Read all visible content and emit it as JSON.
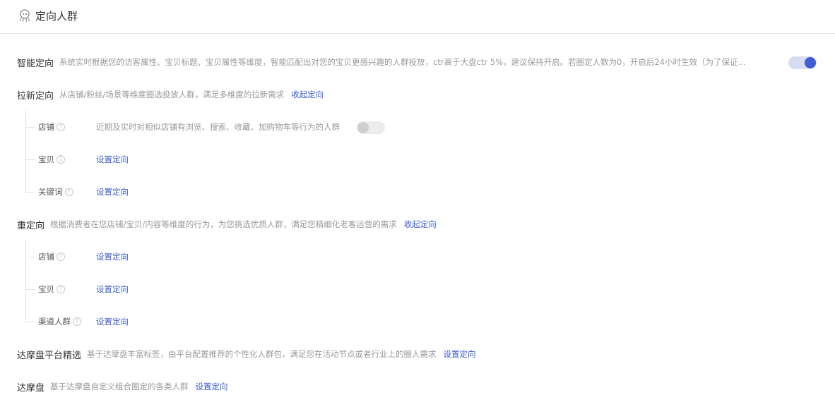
{
  "header": {
    "title": "定向人群",
    "icon": "octopus-icon"
  },
  "smart": {
    "label": "智能定向",
    "desc": "系统实时根据您的访客属性、宝贝标题、宝贝属性等维度，智能匹配出对您的宝贝更感兴趣的人群投放，ctr高于大盘ctr 5%，建议保持开启。若圈定人数为0，开启后24小时生效（为了保证...",
    "toggle_on": true
  },
  "lx": {
    "label": "拉新定向",
    "desc": "从店铺/粉丝/场景等维度圈选投放人群，满足多维度的拉新需求",
    "link": "收起定向",
    "items": [
      {
        "label": "店铺",
        "desc": "近期及实时对相似店铺有浏览、搜索、收藏、加购物车等行为的人群",
        "toggle_on": false
      },
      {
        "label": "宝贝",
        "link": "设置定向"
      },
      {
        "label": "关键词",
        "link": "设置定向"
      }
    ]
  },
  "cdx": {
    "label": "重定向",
    "desc": "根据消费者在您店铺/宝贝/内容等维度的行为，为您挑选优质人群，满足您精细化老客运营的需求",
    "link": "收起定向",
    "items": [
      {
        "label": "店铺",
        "link": "设置定向"
      },
      {
        "label": "宝贝",
        "link": "设置定向"
      },
      {
        "label": "渠道人群",
        "link": "设置定向"
      }
    ]
  },
  "dmp_select": {
    "label": "达摩盘平台精选",
    "desc": "基于达摩盘丰富标签，由平台配置推荐的个性化人群包，满足您在活动节点或者行业上的圈人需求",
    "link": "设置定向"
  },
  "dmp": {
    "label": "达摩盘",
    "desc": "基于达摩盘自定义组合圈定的各类人群",
    "link": "设置定向"
  },
  "help_glyph": "?",
  "colors": {
    "accent": "#3d5dd1",
    "muted": "#999999",
    "toggle_track_on": "#d8dcf3"
  }
}
